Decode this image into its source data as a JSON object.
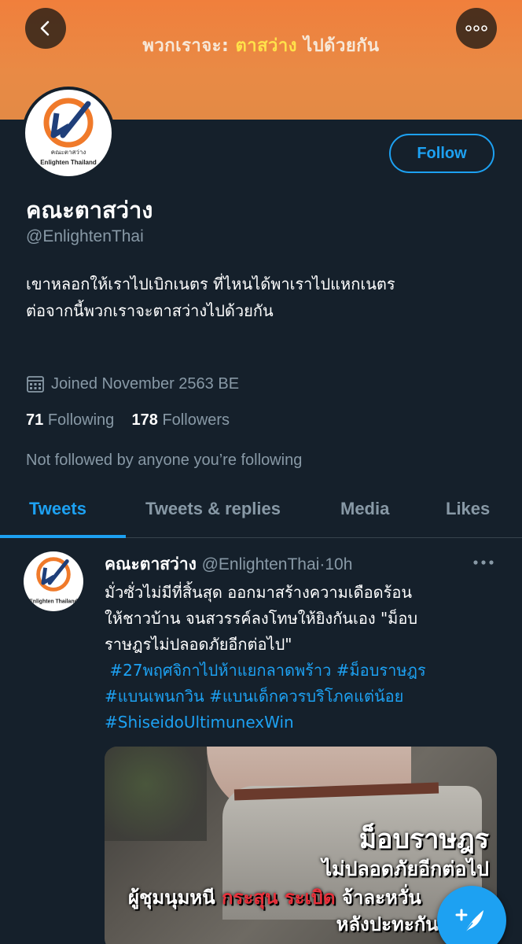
{
  "banner": {
    "text_prefix": "พวกเราจะ: ",
    "text_highlight": "ตาสว่าง",
    "text_suffix": " ไปด้วยกัน",
    "colors": {
      "background": "#e98a45",
      "highlight": "#ffe24a"
    }
  },
  "nav": {
    "back_icon": "chevron-left-icon",
    "more_icon": "more-horizontal-icon"
  },
  "avatar": {
    "logo_text": "คณะตาสว่าง",
    "logo_subtext": "Enlighten Thailand"
  },
  "profile": {
    "follow_label": "Follow",
    "name": "คณะตาสว่าง",
    "handle": "@EnlightenThai",
    "bio_line1": "เขาหลอกให้เราไปเบิกเนตร ที่ไหนได้พาเราไปแหกเนตร",
    "bio_line2": "ต่อจากนี้พวกเราจะตาสว่างไปด้วยกัน",
    "joined": "Joined November 2563 BE",
    "following_count": "71",
    "following_label": "Following",
    "followers_count": "178",
    "followers_label": "Followers",
    "not_followed": "Not followed by anyone you’re following"
  },
  "tabs": [
    {
      "label": "Tweets",
      "active": true
    },
    {
      "label": "Tweets & replies",
      "active": false
    },
    {
      "label": "Media",
      "active": false
    },
    {
      "label": "Likes",
      "active": false
    }
  ],
  "tweet": {
    "name": "คณะตาสว่าง",
    "handle": "@EnlightenThai",
    "separator": "·",
    "time": "10h",
    "body_line1": "มั่วซั่วไม่มีที่สิ้นสุด ออกมาสร้างความเดือดร้อน",
    "body_line2": "ให้ชาวบ้าน จนสวรรค์ลงโทษให้ยิงกันเอง \"ม็อบ",
    "body_line3": "ราษฎรไม่ปลอดภัยอีกต่อไป\"",
    "hashtags": [
      "#27พฤศจิกาไปห้าแยกลาดพร้าว",
      "#ม็อบราษฎร",
      "#แบนเพนกวิน",
      "#แบนเด็กควรบริโภคแต่น้อย",
      "#ShiseidoUltimunexWin"
    ],
    "media": {
      "title": "ม็อบราษฎร",
      "subtitle": "ไม่ปลอดภัยอีกต่อไป",
      "line3_prefix": "ผู้ชุมนุมหนี ",
      "line3_red1": "กระสุน",
      "line3_red2": "ระเบิด",
      "line3_suffix": " จ้าละหวั่น",
      "line4": "หลังปะทะกันเอง"
    }
  },
  "fab": {
    "icon": "compose-tweet-icon"
  },
  "colors": {
    "accent": "#1da1f2",
    "background": "#15202b",
    "muted": "#8899a6"
  }
}
